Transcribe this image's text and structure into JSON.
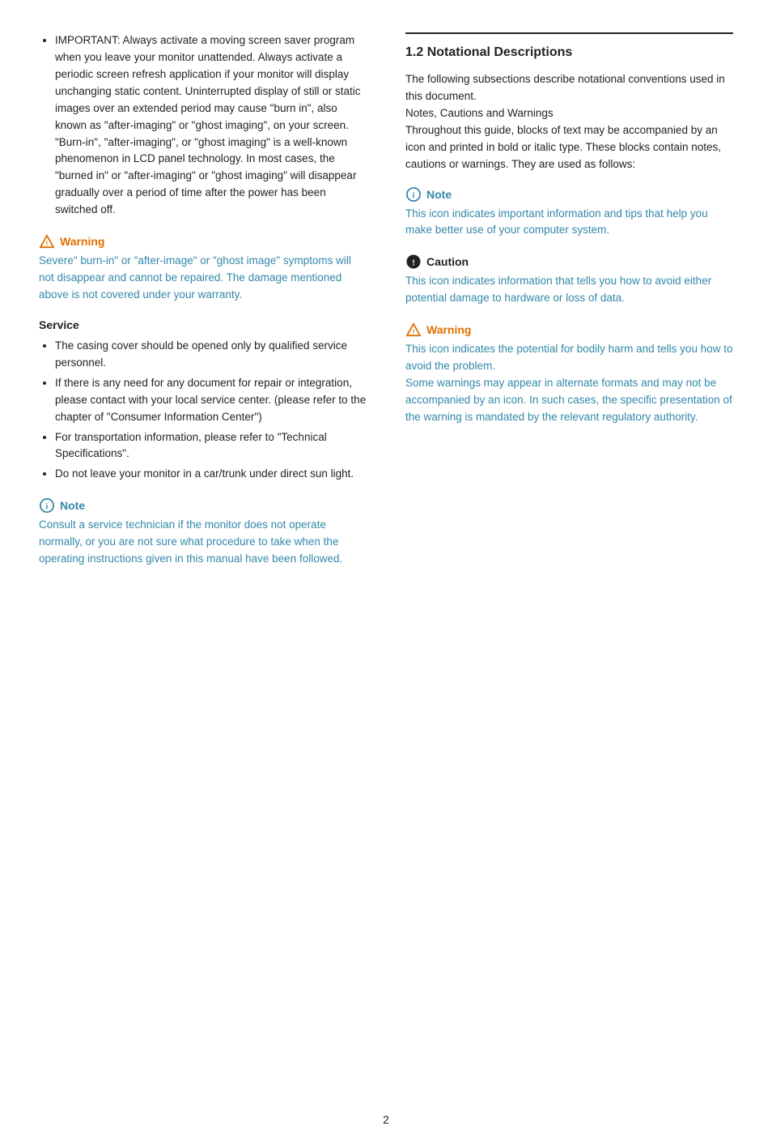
{
  "left": {
    "bullet_intro": [
      "IMPORTANT: Always activate a moving screen saver program when you leave your monitor unattended. Always activate a periodic screen refresh application if your monitor will display unchanging static content. Uninterrupted display of still or static images over an extended period may cause \"burn in\", also known as \"after-imaging\" or \"ghost imaging\", on your screen. \"Burn-in\", \"after-imaging\", or \"ghost imaging\" is a well-known phenomenon in LCD panel technology. In most cases, the \"burned in\" or \"after-imaging\" or \"ghost imaging\" will disappear gradually over a period of time after the power has been switched off."
    ],
    "warning1": {
      "label": "Warning",
      "text": "Severe\" burn-in\" or \"after-image\" or \"ghost image\" symptoms will not disappear and cannot be repaired. The damage mentioned above is not covered under your warranty."
    },
    "service_title": "Service",
    "service_bullets": [
      "The casing cover should be opened only by qualified service personnel.",
      "If there is any need for any document for repair or integration, please contact with your local service center. (please refer to the chapter of \"Consumer Information Center\")",
      "For transportation information, please refer to \"Technical Specifications\".",
      "Do not leave your monitor in a car/trunk under direct sun light."
    ],
    "note1": {
      "label": "Note",
      "text": "Consult a service technician if the monitor does not operate normally, or you are not sure what procedure to take when the operating instructions given in this manual have been followed."
    }
  },
  "right": {
    "section_title": "1.2 Notational Descriptions",
    "intro_text": "The following subsections describe notational conventions used in this document.\nNotes, Cautions and Warnings\nThroughout this guide, blocks of text may be accompanied by an icon and printed in bold or italic type. These blocks contain notes, cautions or warnings. They are used as follows:",
    "note": {
      "label": "Note",
      "text": "This icon indicates important information and tips that help you make better use of your computer system."
    },
    "caution": {
      "label": "Caution",
      "text": "This icon indicates information that tells you how to avoid either potential damage to hardware or loss of data."
    },
    "warning": {
      "label": "Warning",
      "text": "This icon indicates the potential for bodily harm and tells you how to avoid the problem.\nSome warnings may appear in alternate formats and may not be accompanied by an icon. In such cases, the specific presentation of the warning is mandated by the relevant regulatory authority."
    }
  },
  "page_number": "2"
}
